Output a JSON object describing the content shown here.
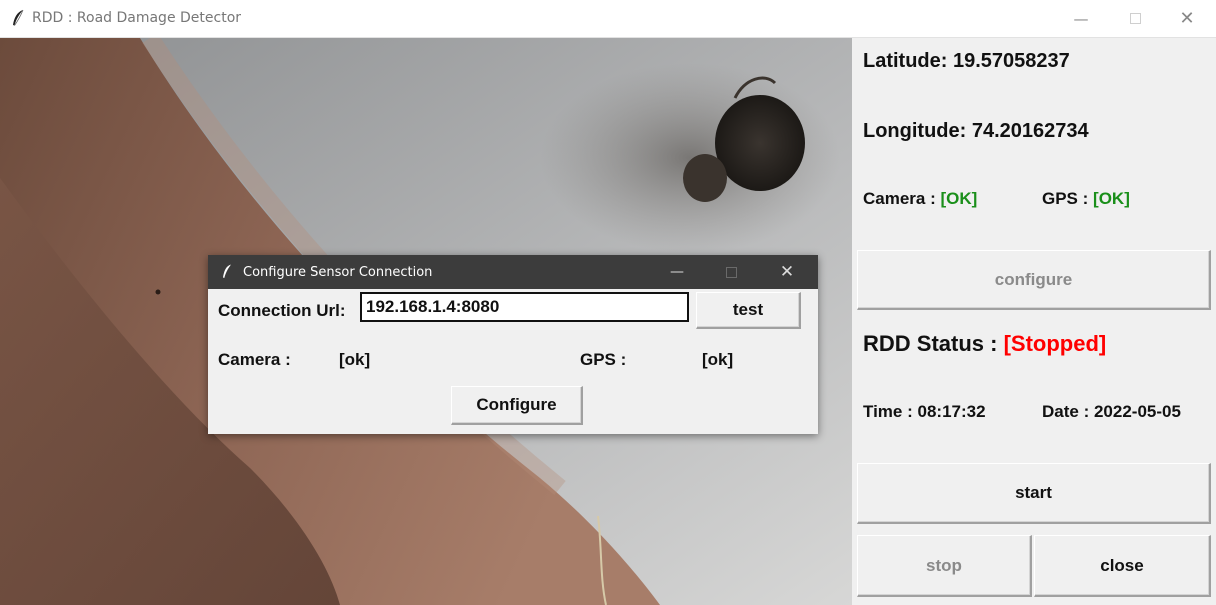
{
  "window": {
    "title": "RDD : Road Damage Detector"
  },
  "panel": {
    "latitude_label": "Latitude:",
    "latitude_value": "19.57058237",
    "longitude_label": "Longitude:",
    "longitude_value": "74.20162734",
    "camera_label": "Camera :",
    "camera_status": "[OK]",
    "gps_label": "GPS :",
    "gps_status": "[OK]",
    "configure_label": "configure",
    "rdd_status_label": "RDD Status :",
    "rdd_status_value": "[Stopped]",
    "time_label": "Time",
    "time_value": ": 08:17:32",
    "date_label": "Date",
    "date_value": ": 2022-05-05",
    "start_label": "start",
    "stop_label": "stop",
    "close_label": "close"
  },
  "dialog": {
    "title": "Configure Sensor Connection",
    "url_label": "Connection Url:",
    "url_value": "192.168.1.4:8080",
    "test_label": "test",
    "camera_label": "Camera :",
    "camera_status": "[ok]",
    "gps_label": "GPS :",
    "gps_status": "[ok]",
    "configure_label": "Configure"
  },
  "colors": {
    "ok": "#1a8f1a",
    "stopped": "#ff0000",
    "dialog_titlebar": "#3c3c3c"
  },
  "icons": [
    "feather-icon",
    "minimize-icon",
    "maximize-icon",
    "close-icon"
  ]
}
